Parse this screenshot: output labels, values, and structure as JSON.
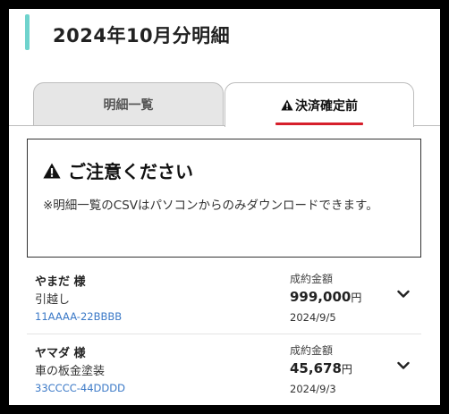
{
  "header": {
    "title": "2024年10月分明細",
    "accent_color": "#6fd3cd"
  },
  "tabs": [
    {
      "label": "明細一覧",
      "active": false
    },
    {
      "label": "決済確定前",
      "active": true,
      "icon": "warning-icon",
      "underline_color": "#d61f2b"
    }
  ],
  "notice": {
    "icon": "warning-icon",
    "title": "ご注意ください",
    "body": "※明細一覧のCSVはパソコンからのみダウンロードできます。"
  },
  "orders": [
    {
      "customer": "やまだ 様",
      "description": "引越し",
      "code": "11AAAA-22BBBB",
      "amount_label": "成約金額",
      "amount": "999,000",
      "unit": "円",
      "date": "2024/9/5"
    },
    {
      "customer": "ヤマダ 様",
      "description": "車の板金塗装",
      "code": "33CCCC-44DDDD",
      "amount_label": "成約金額",
      "amount": "45,678",
      "unit": "円",
      "date": "2024/9/3"
    }
  ]
}
